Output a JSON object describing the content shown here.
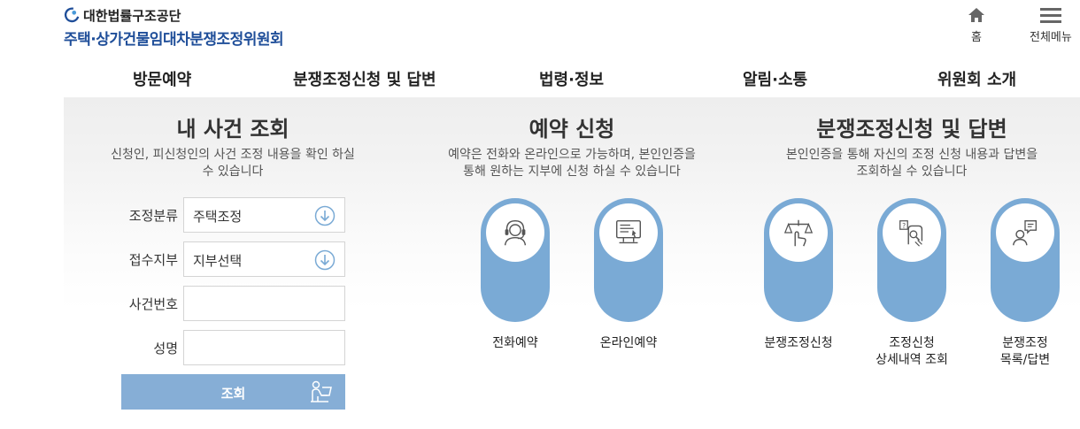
{
  "header": {
    "org_name": "대한법률구조공단",
    "committee_name": "주택·상가건물임대차분쟁조정위원회",
    "home_label": "홈",
    "menu_label": "전체메뉴"
  },
  "gnb": [
    "방문예약",
    "분쟁조정신청 및 답변",
    "법령·정보",
    "알림·소통",
    "위원회 소개"
  ],
  "lookup": {
    "title": "내 사건 조회",
    "desc_line1": "신청인, 피신청인의 사건 조정 내용을 확인 하실",
    "desc_line2": "수 있습니다",
    "fields": [
      {
        "label": "조정분류",
        "value": "주택조정"
      },
      {
        "label": "접수지부",
        "value": "지부선택"
      },
      {
        "label": "사건번호",
        "value": ""
      },
      {
        "label": "성명",
        "value": ""
      }
    ],
    "button_label": "조회"
  },
  "reservation": {
    "title": "예약 신청",
    "desc_line1": "예약은 전화와 온라인으로 가능하며, 본인인증을",
    "desc_line2": "통해 원하는 지부에 신청 하실 수 있습니다",
    "items": [
      {
        "label": "전화예약",
        "icon": "headset-icon"
      },
      {
        "label": "온라인예약",
        "icon": "computer-icon"
      }
    ]
  },
  "dispute": {
    "title": "분쟁조정신청 및 답변",
    "desc_line1": "본인인증을 통해 자신의 조정 신청 내용과 답변을",
    "desc_line2": "조회하실 수 있습니다",
    "items": [
      {
        "line1": "분쟁조정신청",
        "line2": "",
        "icon": "scales-hand-icon"
      },
      {
        "line1": "조정신청",
        "line2": "상세내역 조회",
        "icon": "document-search-icon"
      },
      {
        "line1": "분쟁조정",
        "line2": "목록/답변",
        "icon": "chat-person-icon"
      }
    ]
  },
  "colors": {
    "accent_blue": "#1f4e99",
    "pill_blue": "#7aaad5",
    "button_blue": "#86aed6"
  }
}
